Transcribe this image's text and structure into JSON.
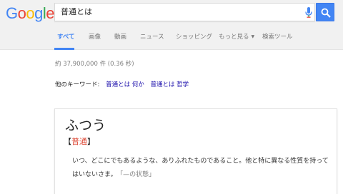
{
  "logo": {
    "text": "Google"
  },
  "search": {
    "query": "普通とは"
  },
  "tabs": [
    {
      "label": "すべて",
      "active": true
    },
    {
      "label": "画像"
    },
    {
      "label": "動画"
    },
    {
      "label": "ニュース"
    },
    {
      "label": "ショッピング"
    },
    {
      "label": "もっと見る"
    },
    {
      "label": "検索ツール"
    }
  ],
  "result_stats": "約 37,900,000 件 (0.36 秒)",
  "keywords": {
    "label": "他のキーワード:",
    "links": [
      "普通とは 何か",
      "普通とは 哲学"
    ]
  },
  "card": {
    "title": "ふつう",
    "bracket_open": "【",
    "kanji": "普通",
    "bracket_close": "】",
    "definition": "いつ、どこにでもあるような、ありふれたものであること。他と特に異なる性質を持ってはいないさま。",
    "example": "「—の状態」"
  },
  "colors": {
    "accent": "#4285f4",
    "link": "#1a0dab",
    "kanji": "#dd4b39"
  }
}
